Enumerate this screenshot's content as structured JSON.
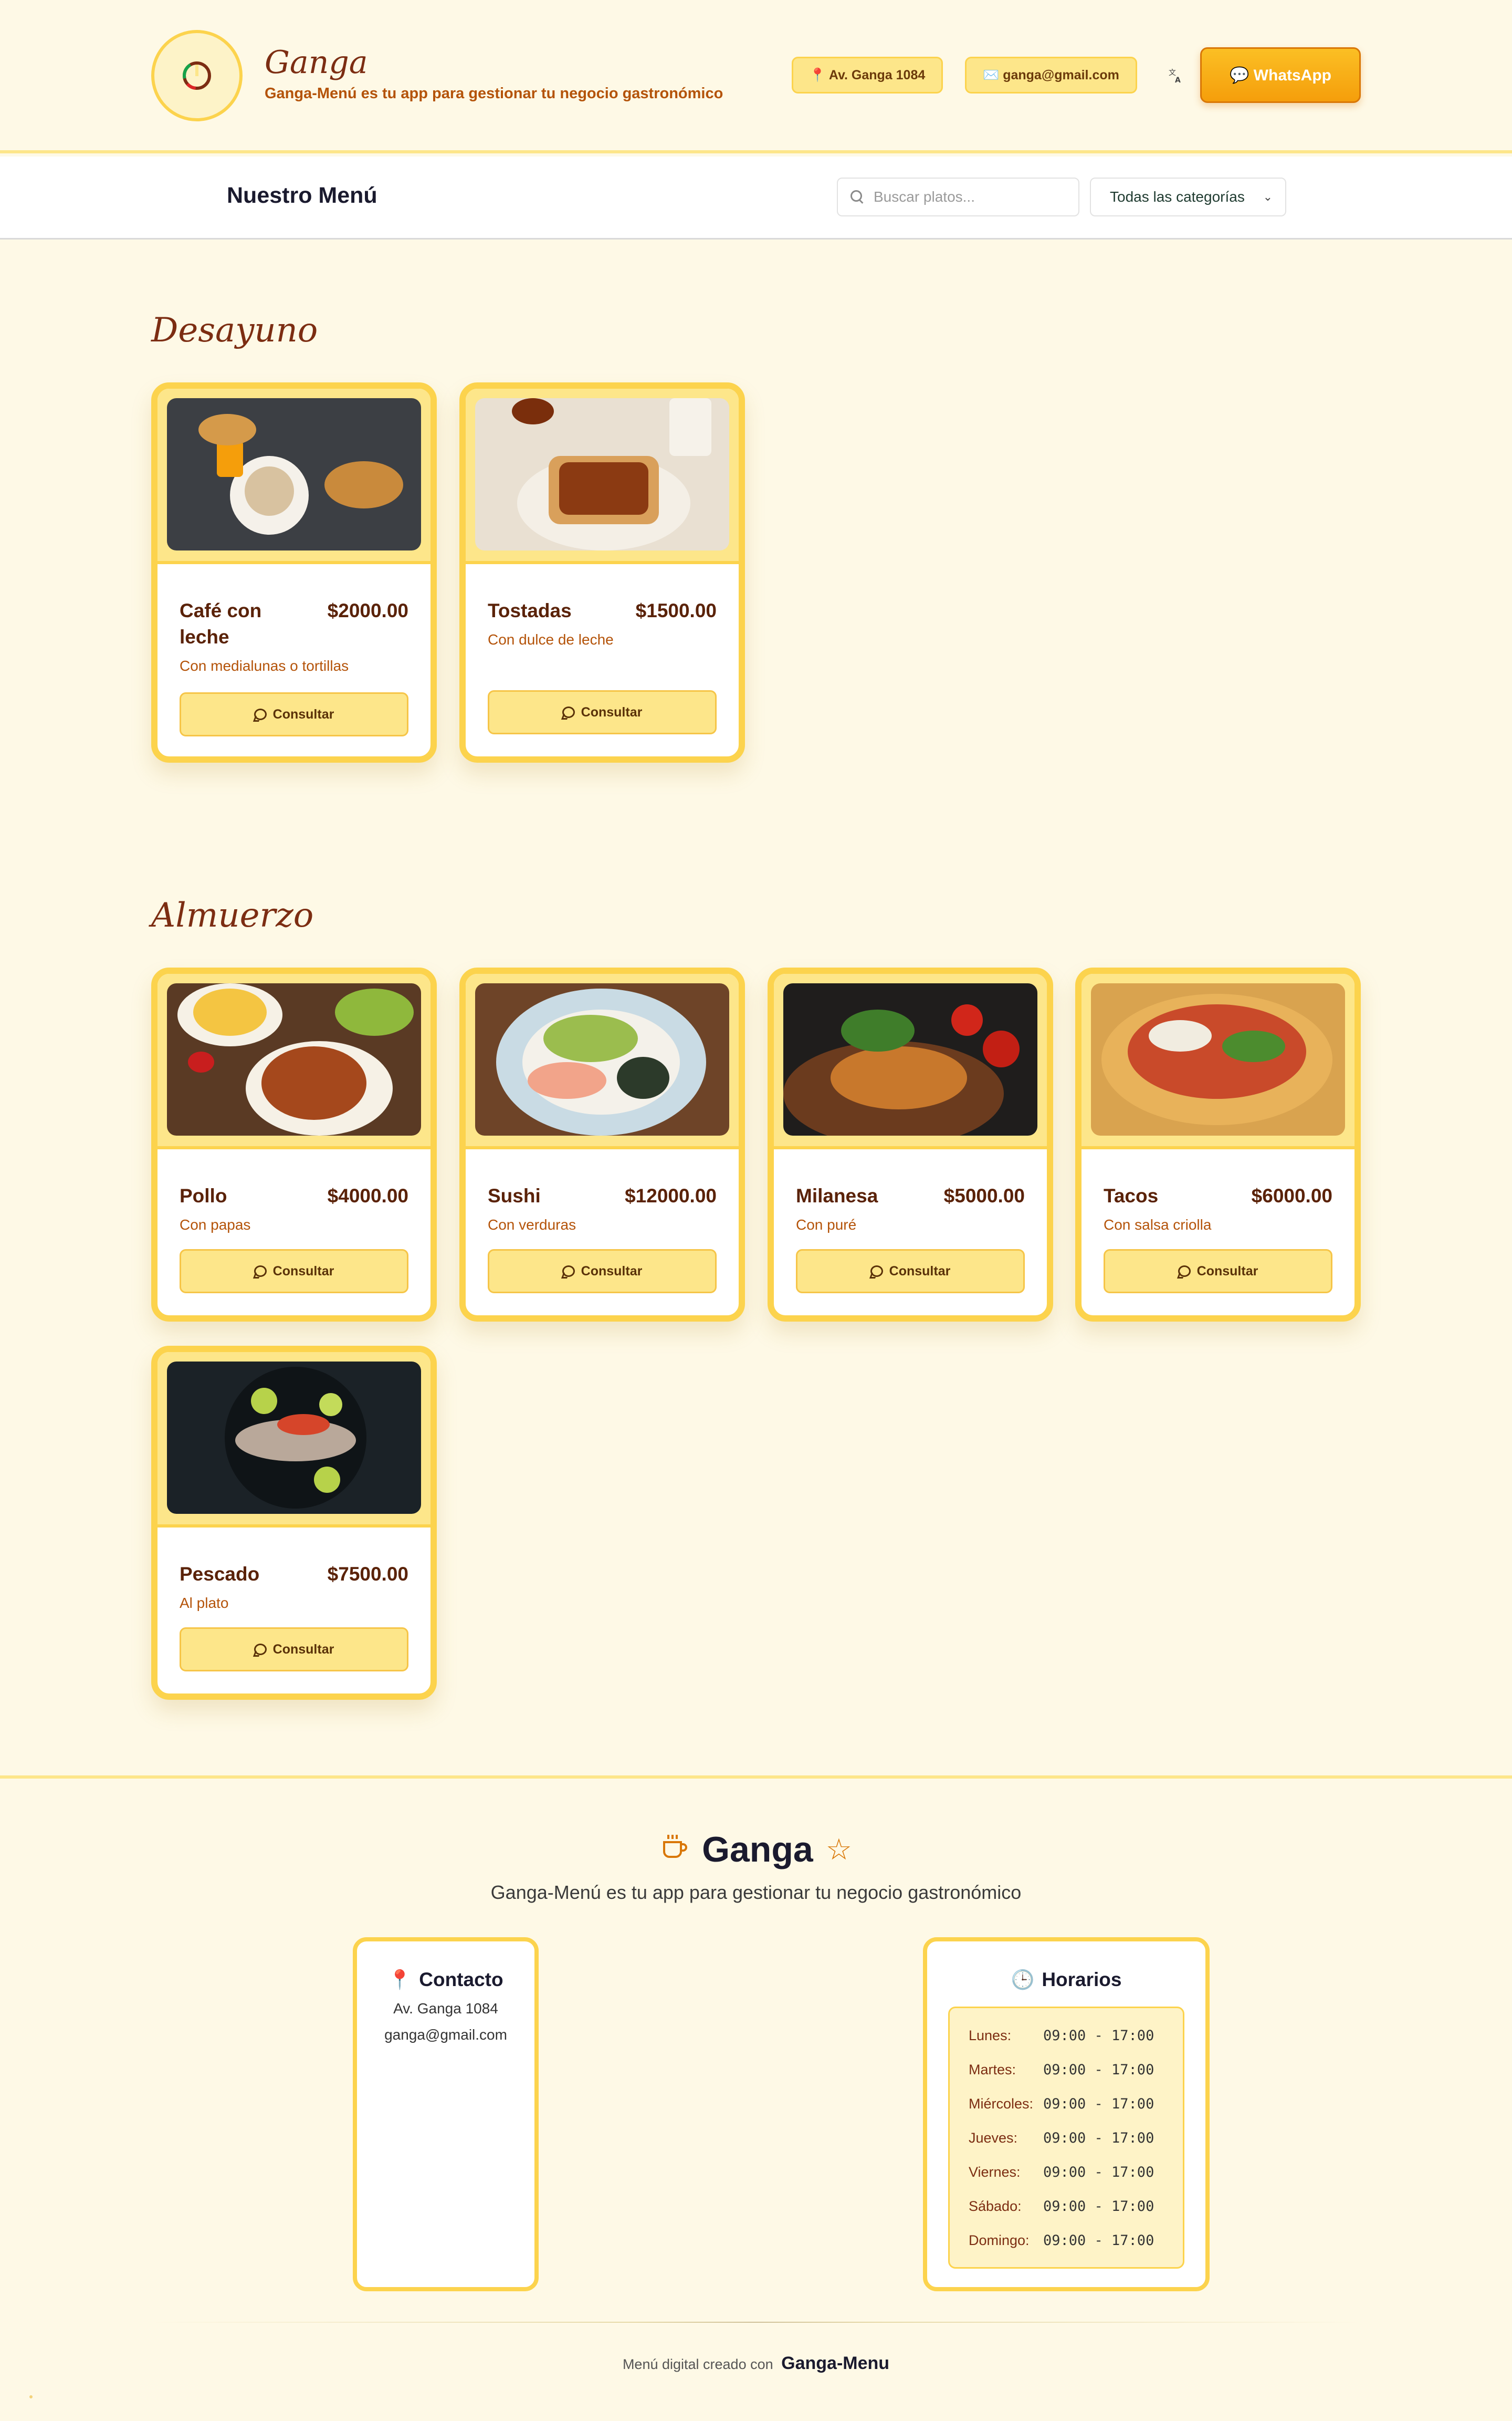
{
  "header": {
    "brand_name": "Ganga",
    "tagline": "Ganga-Menú es tu app para gestionar tu negocio gastronómico",
    "address_label": "📍 Av. Ganga 1084",
    "email_label": "✉️ ganga@gmail.com",
    "translate_icon": "translate-icon",
    "whatsapp_label": "💬 WhatsApp"
  },
  "toolbar": {
    "title": "Nuestro Menú",
    "search_placeholder": "Buscar platos...",
    "category_selected": "Todas las categorías"
  },
  "sections": [
    {
      "title": "Desayuno",
      "items": [
        {
          "name": "Café con leche",
          "price": "$2000.00",
          "description": "Con medialunas o tortillas",
          "button": "Consultar"
        },
        {
          "name": "Tostadas",
          "price": "$1500.00",
          "description": "Con dulce de leche",
          "button": "Consultar"
        }
      ]
    },
    {
      "title": "Almuerzo",
      "items": [
        {
          "name": "Pollo",
          "price": "$4000.00",
          "description": "Con papas",
          "button": "Consultar"
        },
        {
          "name": "Sushi",
          "price": "$12000.00",
          "description": "Con verduras",
          "button": "Consultar"
        },
        {
          "name": "Milanesa",
          "price": "$5000.00",
          "description": "Con puré",
          "button": "Consultar"
        },
        {
          "name": "Tacos",
          "price": "$6000.00",
          "description": "Con salsa criolla",
          "button": "Consultar"
        },
        {
          "name": "Pescado",
          "price": "$7500.00",
          "description": "Al plato",
          "button": "Consultar"
        }
      ]
    }
  ],
  "footer": {
    "brand_name": "Ganga",
    "tagline": "Ganga-Menú es tu app para gestionar tu negocio gastronómico",
    "contact": {
      "title": "Contacto",
      "address": "Av. Ganga 1084",
      "email": "ganga@gmail.com"
    },
    "hours": {
      "title": "Horarios",
      "rows": [
        {
          "day": "Lunes:",
          "time": "09:00 - 17:00"
        },
        {
          "day": "Martes:",
          "time": "09:00 - 17:00"
        },
        {
          "day": "Miércoles:",
          "time": "09:00 - 17:00"
        },
        {
          "day": "Jueves:",
          "time": "09:00 - 17:00"
        },
        {
          "day": "Viernes:",
          "time": "09:00 - 17:00"
        },
        {
          "day": "Sábado:",
          "time": "09:00 - 17:00"
        },
        {
          "day": "Domingo:",
          "time": "09:00 - 17:00"
        }
      ]
    },
    "credit_text": "Menú digital creado con",
    "credit_brand": "Ganga-Menu"
  },
  "colors": {
    "background": "#fef9e6",
    "accent": "#fcd34d",
    "accent_light": "#fde68a",
    "brand_brown": "#7c2d12",
    "whatsapp_orange": "#f59e0b"
  }
}
